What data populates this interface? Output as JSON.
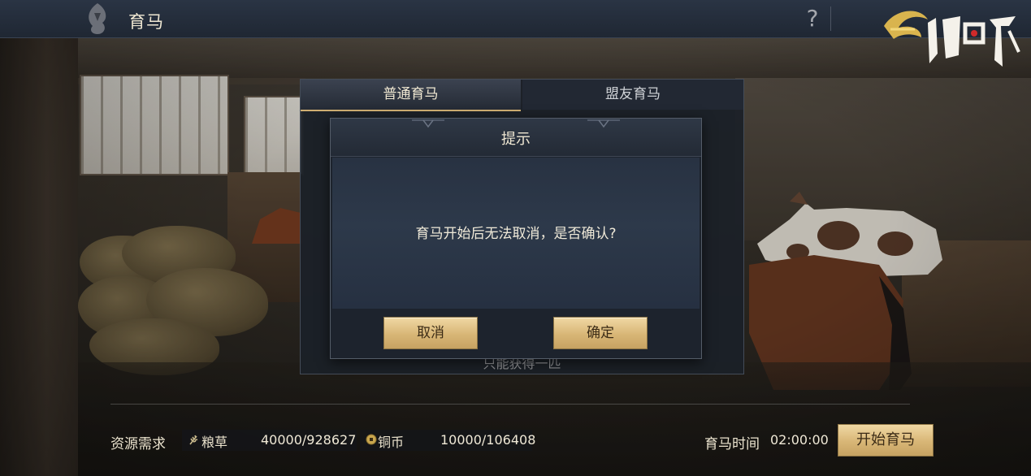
{
  "header": {
    "title": "育马",
    "help_label": "?",
    "logo_text": "鸿图之下"
  },
  "breeding_panel": {
    "tabs": [
      {
        "label": "普通育马",
        "selected": true
      },
      {
        "label": "盟友育马",
        "selected": false
      }
    ],
    "note": "只能获得一匹"
  },
  "dialog": {
    "title": "提示",
    "message": "育马开始后无法取消，是否确认?",
    "cancel_label": "取消",
    "confirm_label": "确定"
  },
  "footer": {
    "resource_label": "资源需求",
    "resources": [
      {
        "name": "粮草",
        "value": "40000/928627",
        "icon": "grain-icon"
      },
      {
        "name": "铜币",
        "value": "10000/106408",
        "icon": "coin-icon"
      }
    ],
    "time_label": "育马时间",
    "time_value": "02:00:00",
    "start_label": "开始育马"
  },
  "colors": {
    "accent_gold": "#d8b676",
    "topbar_bg": "#1f2733",
    "panel_bg": "#1b2028"
  }
}
